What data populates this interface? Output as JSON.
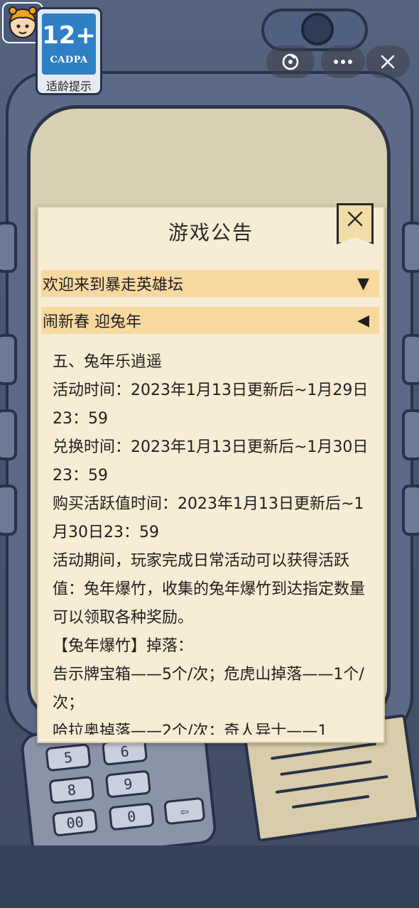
{
  "age_rating": {
    "number": "12+",
    "org": "CADPA",
    "label": "适龄提示"
  },
  "keypad_keys": [
    "5",
    "6",
    "8",
    "9",
    "00",
    "0"
  ],
  "dialog": {
    "title": "游戏公告",
    "sections": [
      {
        "label": "欢迎来到暴走英雄坛",
        "arrow": "▼"
      },
      {
        "label": "闹新春 迎兔年",
        "arrow": "◀"
      }
    ],
    "content": [
      "五、兔年乐逍遥",
      "活动时间：2023年1月13日更新后~1月29日23：59",
      "兑换时间：2023年1月13日更新后~1月30日23：59",
      "购买活跃值时间：2023年1月13日更新后~1月30日23：59",
      "活动期间，玩家完成日常活动可以获得活跃值：兔年爆竹，收集的兔年爆竹到达指定数量可以领取各种奖励。",
      "【兔年爆竹】掉落：",
      "告示牌宝箱——5个/次；危虎山掉落——1个/次；",
      "哈拉奥掉落——2个/次；奇人异士——1"
    ]
  },
  "colors": {
    "dialog_bg": "#f7ecd4",
    "section_bg": "#f7d9a0",
    "badge_blue": "#2e7fc4"
  }
}
